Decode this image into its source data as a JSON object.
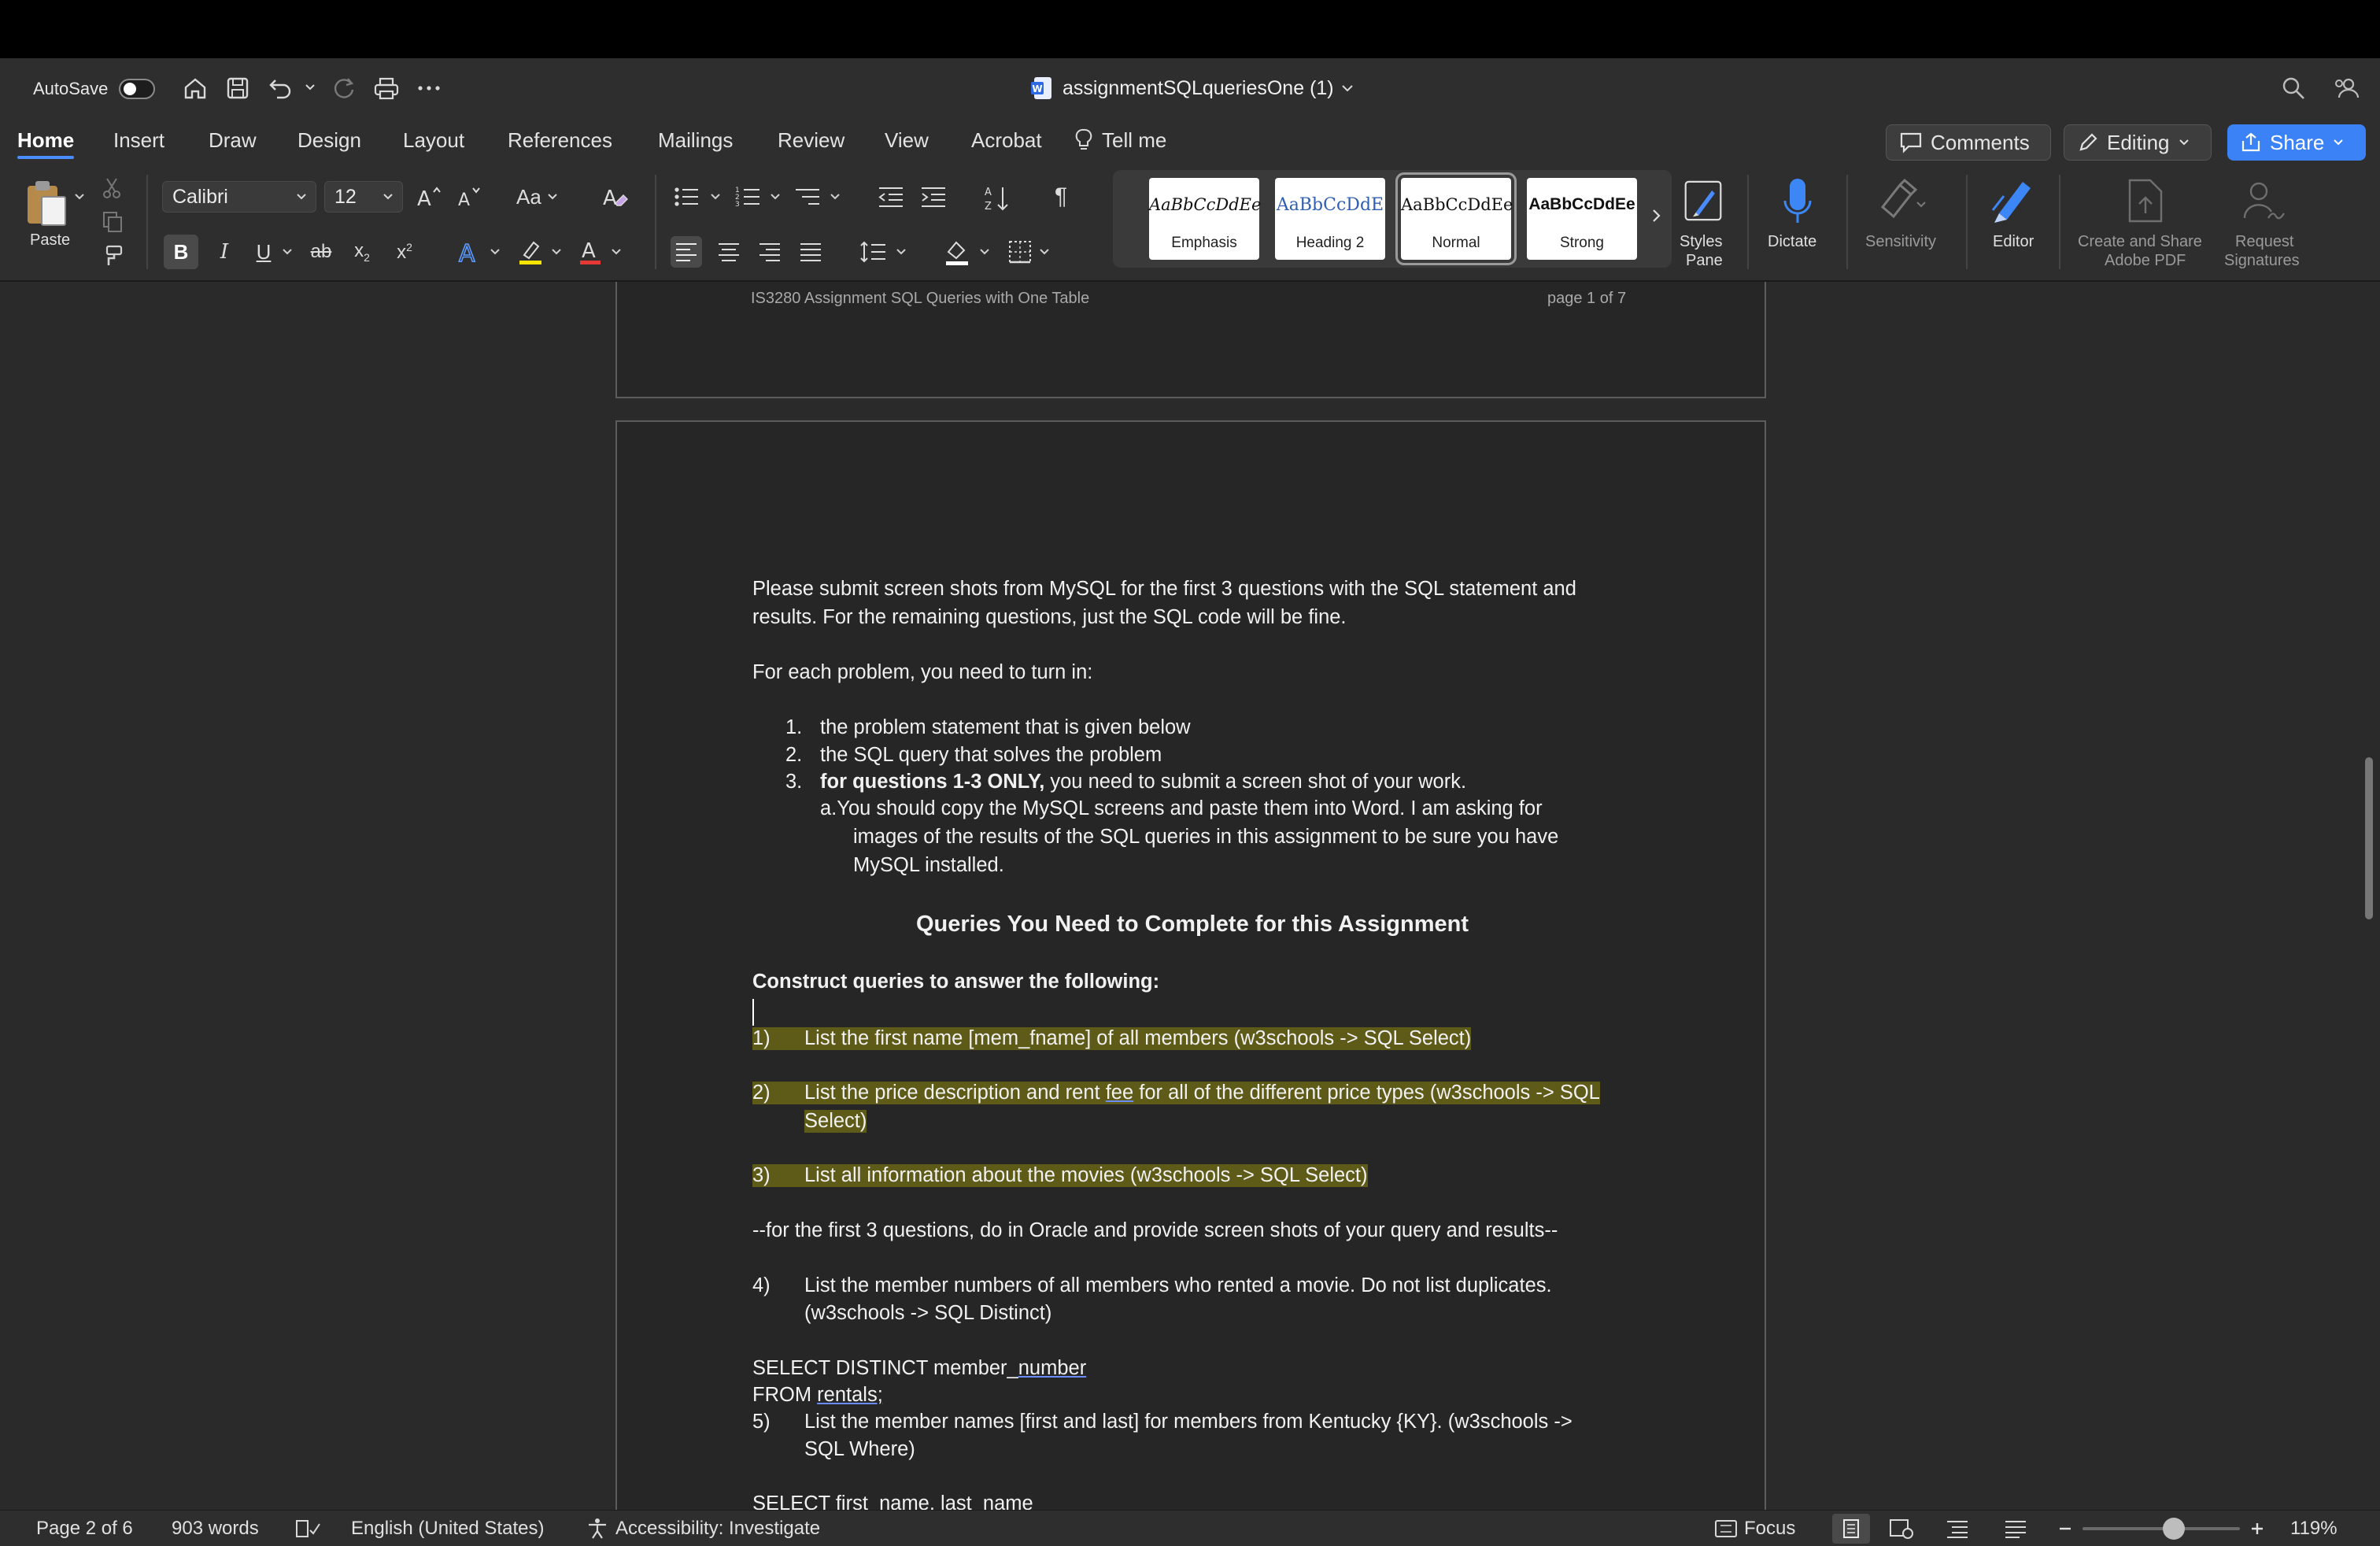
{
  "window": {
    "title": "assignmentSQLqueriesOne (1)",
    "autosave_label": "AutoSave"
  },
  "ribbon_tabs": [
    "Home",
    "Insert",
    "Draw",
    "Design",
    "Layout",
    "References",
    "Mailings",
    "Review",
    "View",
    "Acrobat"
  ],
  "tell_me": "Tell me",
  "actions": {
    "comments": "Comments",
    "editing": "Editing",
    "share": "Share"
  },
  "toolbar": {
    "paste": "Paste",
    "font_name": "Calibri",
    "font_size": "12",
    "change_case": "Aa",
    "styles": [
      {
        "sample": "AaBbCcDdEe",
        "name": "Emphasis"
      },
      {
        "sample": "AaBbCcDdE",
        "name": "Heading 2"
      },
      {
        "sample": "AaBbCcDdEe",
        "name": "Normal"
      },
      {
        "sample": "AaBbCcDdEe",
        "name": "Strong"
      }
    ],
    "styles_pane": [
      "Styles",
      "Pane"
    ],
    "dictate": "Dictate",
    "sensitivity": "Sensitivity",
    "editor": "Editor",
    "create_share": [
      "Create and Share",
      "Adobe PDF"
    ],
    "request_sig": [
      "Request",
      "Signatures"
    ]
  },
  "page1": {
    "header_left": "IS3280 Assignment SQL Queries with One Table",
    "header_right": "page 1 of 7"
  },
  "document": {
    "intro_1": "Please submit screen shots from MySQL for the first 3 questions with the SQL statement and",
    "intro_2": "results.  For the remaining questions, just the SQL code will be fine.",
    "each_problem": "For each problem, you need to turn in:",
    "list": [
      {
        "num": "1.",
        "text": "the problem statement that is given below"
      },
      {
        "num": "2.",
        "text": "the SQL query that solves the problem"
      },
      {
        "num": "3.",
        "bold": "for questions 1-3 ONLY,",
        "text": " you need to submit a screen shot of your work."
      }
    ],
    "sub_a": "a.",
    "sub_1": "You should copy the MySQL screens and paste them into Word.  I am asking for",
    "sub_2": "images of the results of the SQL queries in this assignment to be sure you have",
    "sub_3": "MySQL installed.",
    "heading": "Queries You Need to Complete for this Assignment",
    "construct": "Construct queries to answer the following:",
    "q1_num": "1)",
    "q1": "List the first name [mem_fname] of all members (w3schools -> SQL Select)",
    "q2_num": "2)",
    "q2_a": "List the price description and rent ",
    "q2_fee": "fee",
    "q2_b": " for all of the different price types (w3schools -> SQL",
    "q2_c": "Select)",
    "q3_num": "3)",
    "q3": "List all information about the movies (w3schools -> SQL Select)",
    "note": "--for the first 3 questions, do in Oracle and provide screen shots of your query and results--",
    "q4_num": "4)",
    "q4_a": "List the member numbers of all members who rented a movie.  Do not list duplicates.",
    "q4_b": "(w3schools -> SQL Distinct)",
    "sql1_a": "SELECT DISTINCT member_",
    "sql1_b": "number",
    "sql2_a": "FROM ",
    "sql2_b": "rentals;",
    "q5_num": "5)",
    "q5_a": "List the member names [first and last] for members from Kentucky {KY}.  (w3schools ->",
    "q5_b": "SQL Where)",
    "sql3": "SELECT first_name, last_name"
  },
  "status": {
    "page": "Page 2 of 6",
    "words": "903 words",
    "language": "English (United States)",
    "accessibility": "Accessibility: Investigate",
    "focus": "Focus",
    "zoom": "119%",
    "zoom_level": 0.58
  },
  "colors": {
    "accent": "#4a8cff",
    "share_bg": "#3b82f6",
    "highlight": "#5e5a18"
  }
}
